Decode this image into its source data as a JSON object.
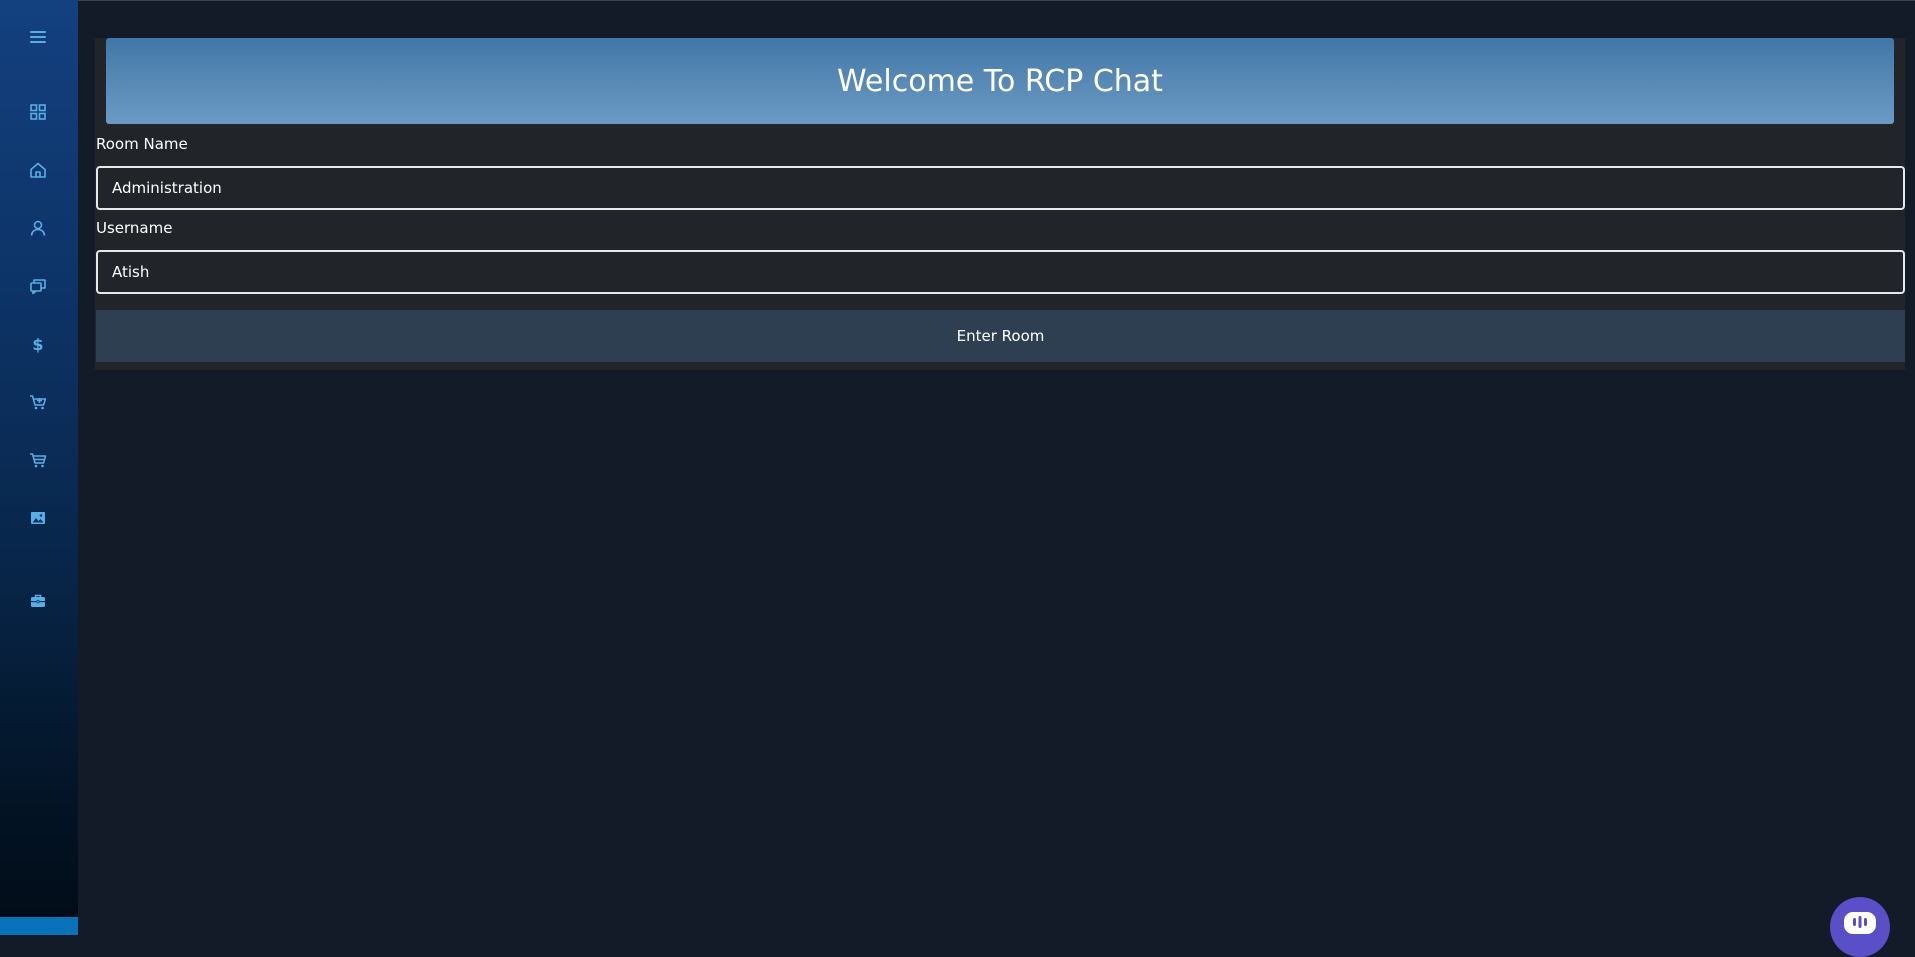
{
  "sidebar": {
    "icons": [
      {
        "name": "menu-icon"
      },
      {
        "name": "dashboard-icon"
      },
      {
        "name": "home-icon"
      },
      {
        "name": "user-icon"
      },
      {
        "name": "chat-icon"
      },
      {
        "name": "dollar-icon"
      },
      {
        "name": "cart-add-icon"
      },
      {
        "name": "cart-icon"
      },
      {
        "name": "image-icon"
      },
      {
        "name": "briefcase-icon"
      }
    ],
    "icon_color": "#5aaee6"
  },
  "banner": {
    "title": "Welcome To RCP Chat"
  },
  "form": {
    "room_label": "Room Name",
    "room_value": "Administration",
    "username_label": "Username",
    "username_value": "Atish",
    "submit_label": "Enter Room"
  },
  "chat_widget": {
    "icon": "chat-bubble-icon",
    "color": "#5a4fc7"
  }
}
